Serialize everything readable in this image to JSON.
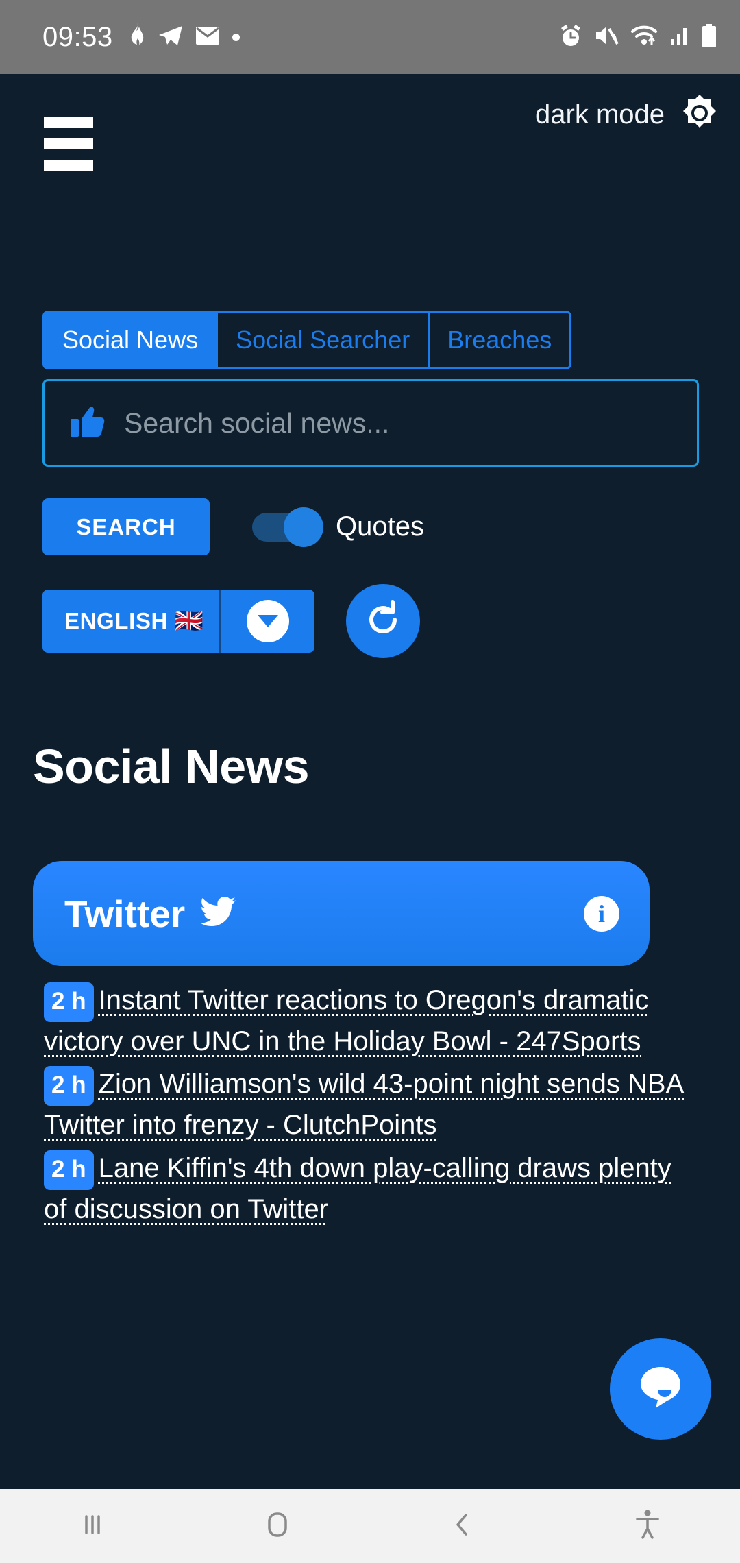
{
  "statusbar": {
    "time": "09:53",
    "left_icons": [
      "fire-icon",
      "telegram-icon",
      "mail-icon",
      "dot-icon"
    ],
    "right_icons": [
      "alarm-icon",
      "mute-icon",
      "wifi-icon",
      "signal-icon",
      "battery-icon"
    ]
  },
  "header": {
    "dark_mode_label": "dark mode",
    "brightness_icon": "brightness-icon",
    "menu_icon": "hamburger-menu-icon"
  },
  "tabs": [
    {
      "label": "Social News",
      "active": true
    },
    {
      "label": "Social Searcher",
      "active": false
    },
    {
      "label": "Breaches",
      "active": false
    }
  ],
  "search": {
    "icon": "thumbs-up-icon",
    "placeholder": "Search social news...",
    "value": "",
    "button_label": "SEARCH",
    "quotes_label": "Quotes",
    "quotes_enabled": true
  },
  "language": {
    "label": "ENGLISH",
    "flag": "🇬🇧",
    "caret_icon": "chevron-down-icon",
    "refresh_icon": "refresh-icon"
  },
  "page": {
    "heading": "Social News"
  },
  "network_card": {
    "name": "Twitter",
    "icon": "twitter-bird-icon",
    "info_label": "i"
  },
  "news": [
    {
      "time": "2 h",
      "title": "Instant Twitter reactions to Oregon's dramatic victory over UNC in the Holiday Bowl - 247Sports"
    },
    {
      "time": "2 h",
      "title": "Zion Williamson's wild 43-point night sends NBA Twitter into frenzy - ClutchPoints"
    },
    {
      "time": "2 h",
      "title": "Lane Kiffin's 4th down play-calling draws plenty of discussion on Twitter"
    }
  ],
  "fab": {
    "icon": "chat-bubble-icon"
  },
  "navbar": {
    "buttons": [
      "recents-icon",
      "home-icon",
      "back-icon",
      "accessibility-icon"
    ]
  },
  "colors": {
    "background": "#0e1e2d",
    "accent": "#1b7ced",
    "accent_light": "#2a86ff",
    "statusbar": "#767676",
    "navbar": "#f2f2f2",
    "placeholder": "#8d9aa4"
  }
}
